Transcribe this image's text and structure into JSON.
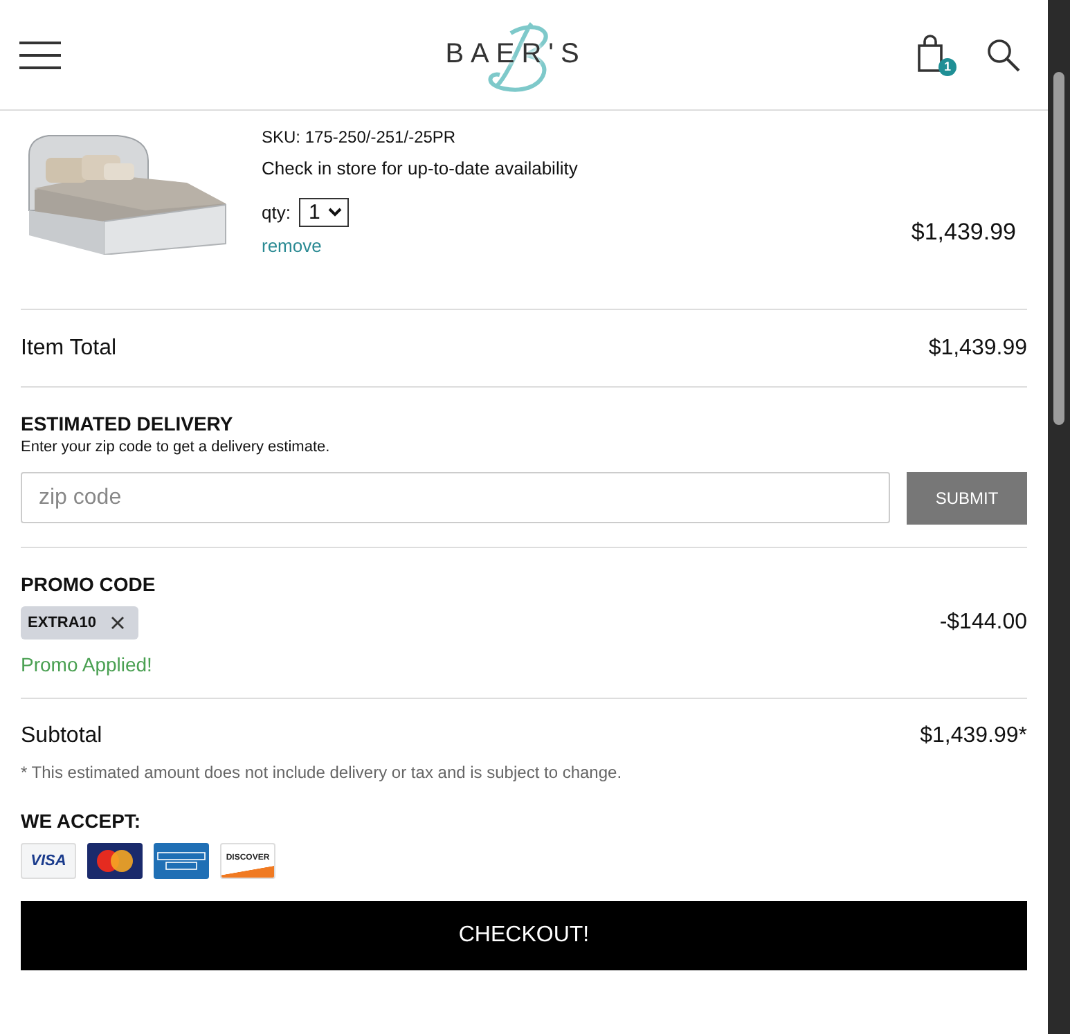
{
  "header": {
    "logo": "BAER'S",
    "cart_count": "1"
  },
  "item": {
    "sku": "SKU: 175-250/-251/-25PR",
    "availability": "Check in store for up-to-date availability",
    "qty_label": "qty:",
    "qty": "1",
    "remove": "remove",
    "price": "$1,439.99"
  },
  "item_total": {
    "label": "Item Total",
    "value": "$1,439.99"
  },
  "delivery": {
    "heading": "ESTIMATED DELIVERY",
    "hint": "Enter your zip code to get a delivery estimate.",
    "placeholder": "zip code",
    "button": "SUBMIT"
  },
  "promo": {
    "heading": "PROMO CODE",
    "code": "EXTRA10",
    "discount": "-$144.00",
    "status": "Promo Applied!"
  },
  "subtotal": {
    "label": "Subtotal",
    "value": "$1,439.99*",
    "note": "* This estimated amount does not include delivery or tax and is subject to change."
  },
  "accept": {
    "heading": "WE ACCEPT:",
    "cards": [
      {
        "kind": "visa",
        "label": "VISA"
      },
      {
        "kind": "mastercard"
      },
      {
        "kind": "amex"
      },
      {
        "kind": "discover",
        "label": "DISCOVER"
      }
    ]
  },
  "checkout": "CHECKOUT!"
}
